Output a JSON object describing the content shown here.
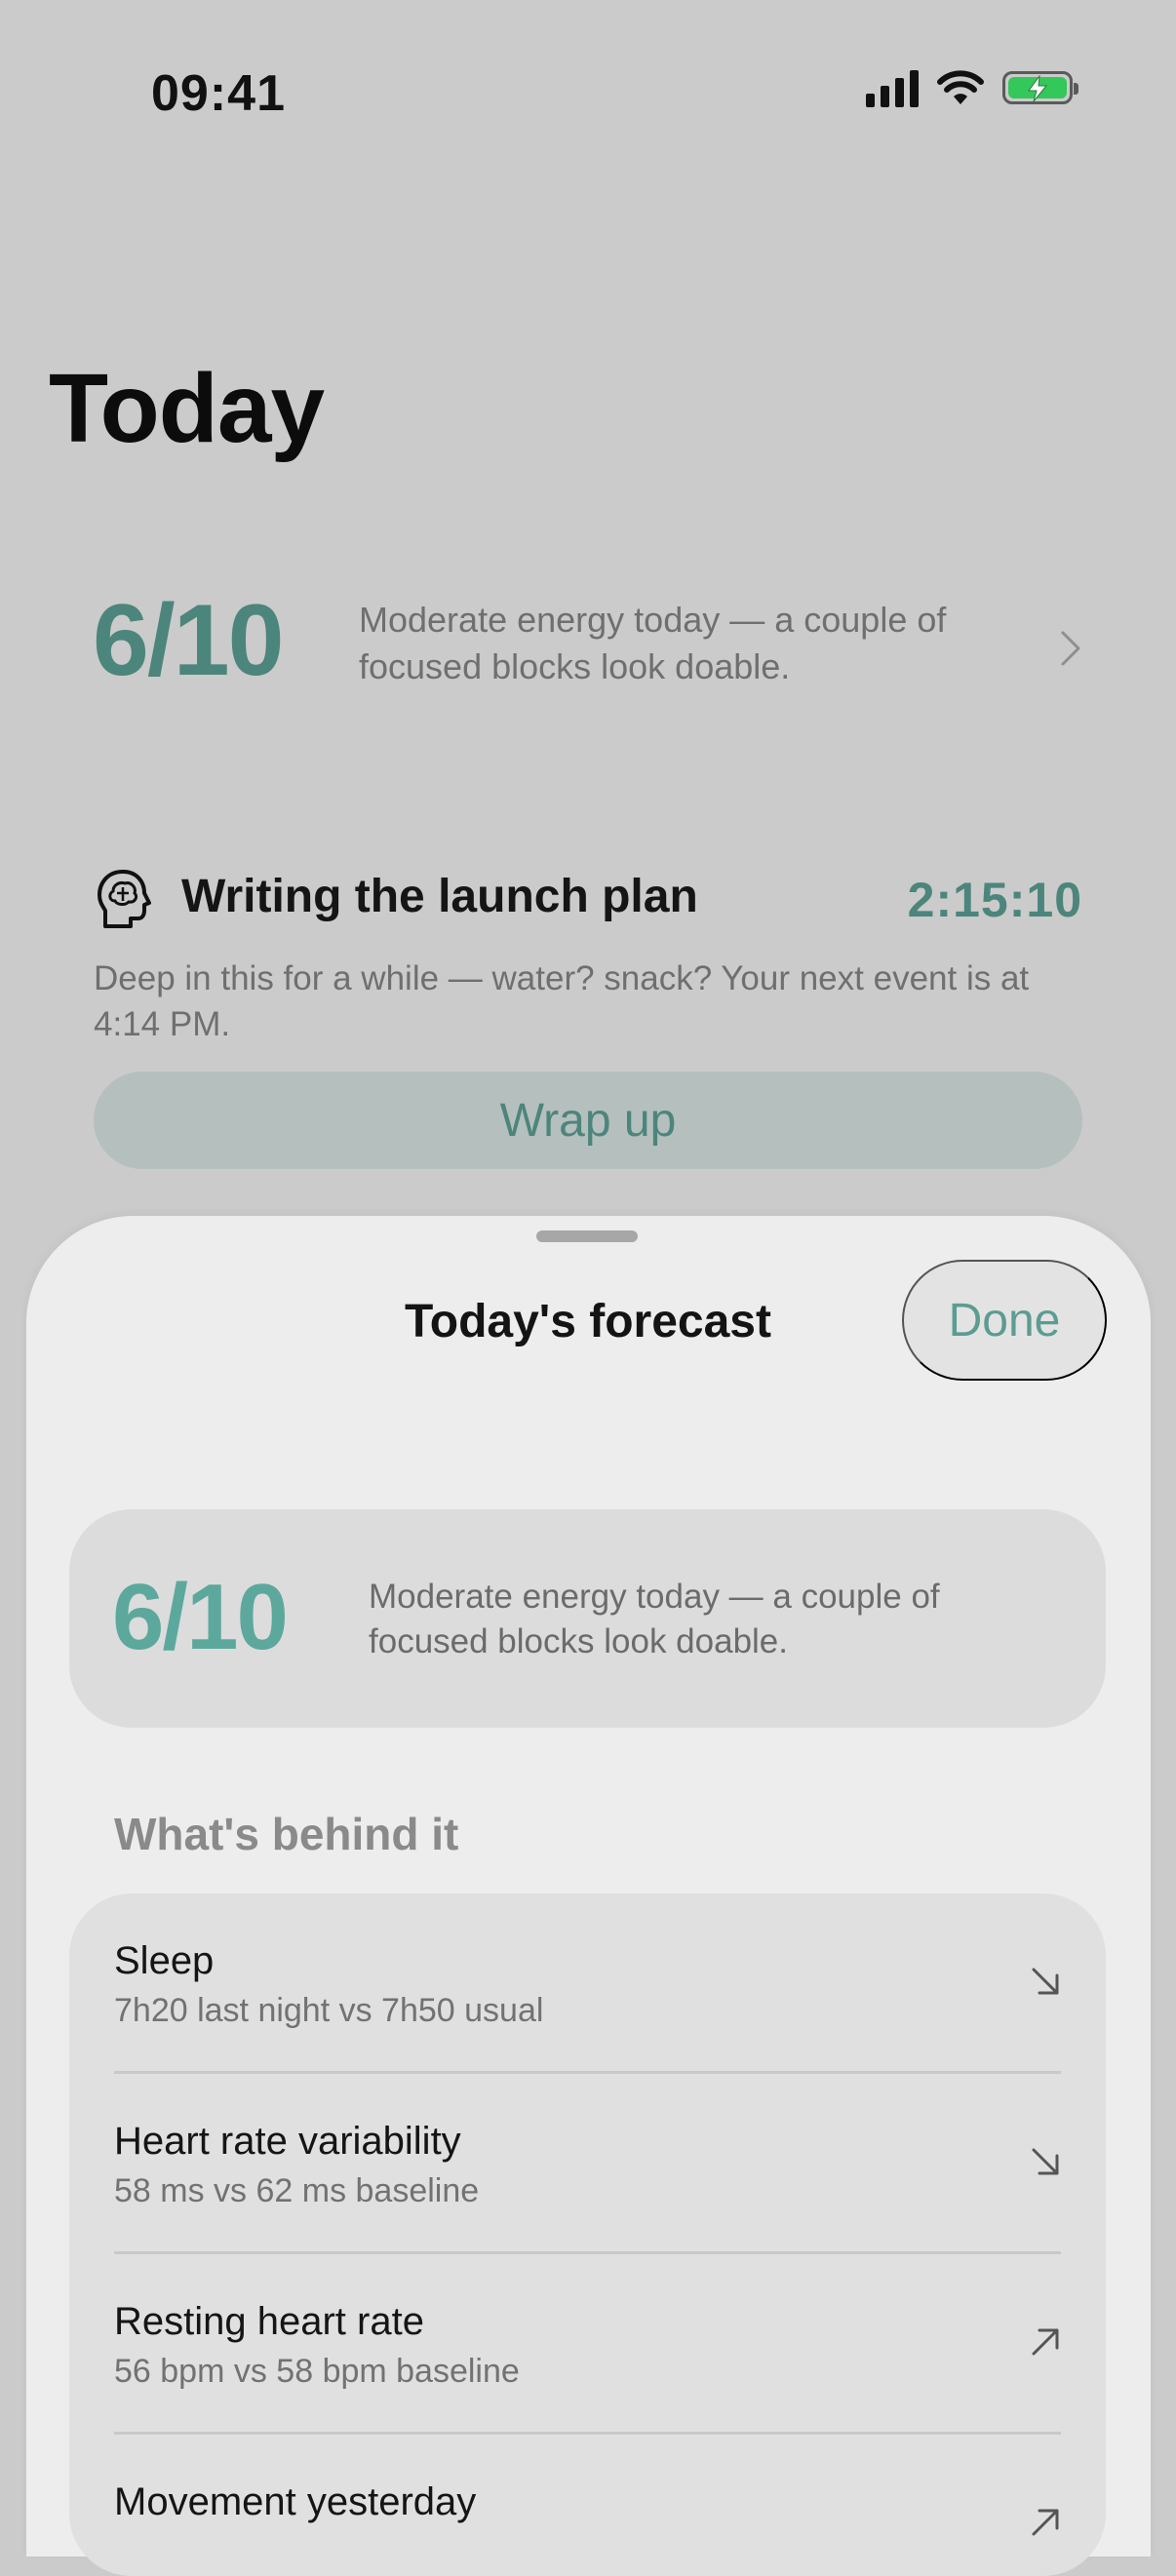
{
  "status_bar": {
    "time": "09:41"
  },
  "page": {
    "title": "Today"
  },
  "energy": {
    "score": "6/10",
    "description": "Moderate energy today — a couple of focused blocks look doable."
  },
  "current_task": {
    "title": "Writing the launch plan",
    "timer": "2:15:10",
    "note": "Deep in this for a while — water? snack? Your next event is at 4:14 PM.",
    "button_label": "Wrap up"
  },
  "sheet": {
    "title": "Today's forecast",
    "done_label": "Done",
    "score": "6/10",
    "description": "Moderate energy today — a couple of focused blocks look doable.",
    "section_title": "What's behind it",
    "factors": [
      {
        "name": "Sleep",
        "detail": "7h20 last night vs 7h50 usual",
        "trend": "down-right-arrow"
      },
      {
        "name": "Heart rate variability",
        "detail": "58 ms vs 62 ms baseline",
        "trend": "down-right-arrow"
      },
      {
        "name": "Resting heart rate",
        "detail": "56 bpm vs 58 bpm baseline",
        "trend": "up-right-arrow"
      },
      {
        "name": "Movement yesterday",
        "detail": "",
        "trend": "up-right-arrow"
      }
    ]
  },
  "colors": {
    "accent": "#4c857c",
    "accent_light": "#5ca89c",
    "battery": "#34c759"
  }
}
